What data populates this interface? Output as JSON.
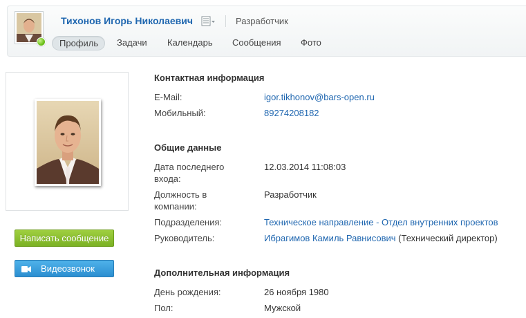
{
  "header": {
    "name": "Тихонов Игорь Николаевич",
    "position": "Разработчик",
    "tabs": [
      "Профиль",
      "Задачи",
      "Календарь",
      "Сообщения",
      "Фото"
    ]
  },
  "actions": {
    "write_message": "Написать сообщение",
    "video_call": "Видеозвонок"
  },
  "contact": {
    "title": "Контактная информация",
    "email_label": "E-Mail:",
    "email": "igor.tikhonov@bars-open.ru",
    "mobile_label": "Мобильный:",
    "mobile": "89274208182"
  },
  "general": {
    "title": "Общие данные",
    "last_login_label_1": "Дата последнего",
    "last_login_label_2": "входа:",
    "last_login": "12.03.2014 11:08:03",
    "position_label_1": "Должность в",
    "position_label_2": "компании:",
    "position": "Разработчик",
    "department_label": "Подразделения:",
    "department": "Техническое направление - Отдел внутренних проектов",
    "manager_label": "Руководитель:",
    "manager": "Ибрагимов Камиль Равнисович",
    "manager_role": "(Технический директор)"
  },
  "extra": {
    "title": "Дополнительная информация",
    "birthday_label": "День рождения:",
    "birthday": "26 ноября 1980",
    "gender_label": "Пол:",
    "gender": "Мужской"
  },
  "colors": {
    "link": "#2067b0",
    "green_button": "#8cc132",
    "blue_button": "#3aa0dd",
    "online": "#6cc11b"
  },
  "icons": {
    "online_status": "online-status-icon",
    "name_menu": "list-menu-icon",
    "video": "video-camera-icon"
  }
}
